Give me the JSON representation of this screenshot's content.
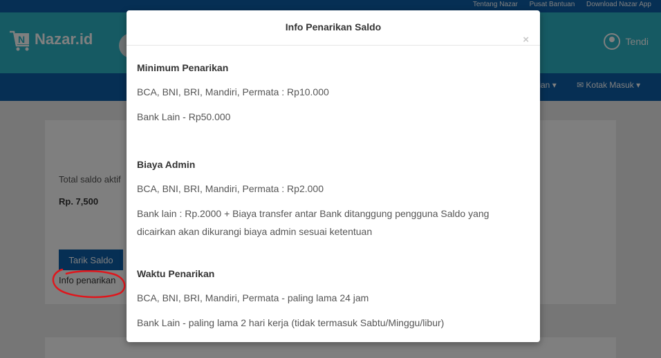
{
  "topbar": {
    "links": [
      "Tentang Nazar",
      "Pusat Bantuan",
      "Download Nazar App"
    ]
  },
  "header": {
    "logo_text": "Nazar.id",
    "user_name": "Tendi"
  },
  "navbar": {
    "items": [
      "...elian",
      "Kotak Masuk"
    ]
  },
  "saldo": {
    "label": "Total saldo aktif",
    "value": "Rp. 7,500",
    "withdraw_button": "Tarik Saldo",
    "info_link": "Info penarikan"
  },
  "modal": {
    "title": "Info Penarikan Saldo",
    "close_glyph": "×",
    "sections": [
      {
        "title": "Minimum Penarikan",
        "lines": [
          "BCA, BNI, BRI, Mandiri, Permata : Rp10.000",
          "Bank Lain - Rp50.000"
        ]
      },
      {
        "title": "Biaya Admin",
        "lines": [
          "BCA, BNI, BRI, Mandiri, Permata : Rp2.000",
          "Bank lain : Rp.2000 + Biaya transfer antar Bank ditanggung pengguna Saldo yang dicairkan akan dikurangi biaya admin sesuai ketentuan"
        ]
      },
      {
        "title": "Waktu Penarikan",
        "lines": [
          "BCA, BNI, BRI, Mandiri, Permata - paling lama 24 jam",
          "Bank Lain - paling lama 2 hari kerja (tidak termasuk Sabtu/Minggu/libur)"
        ]
      }
    ]
  },
  "colors": {
    "primary": "#0d5fa8",
    "header": "#2cb5c6",
    "annotation": "#e0161c"
  }
}
